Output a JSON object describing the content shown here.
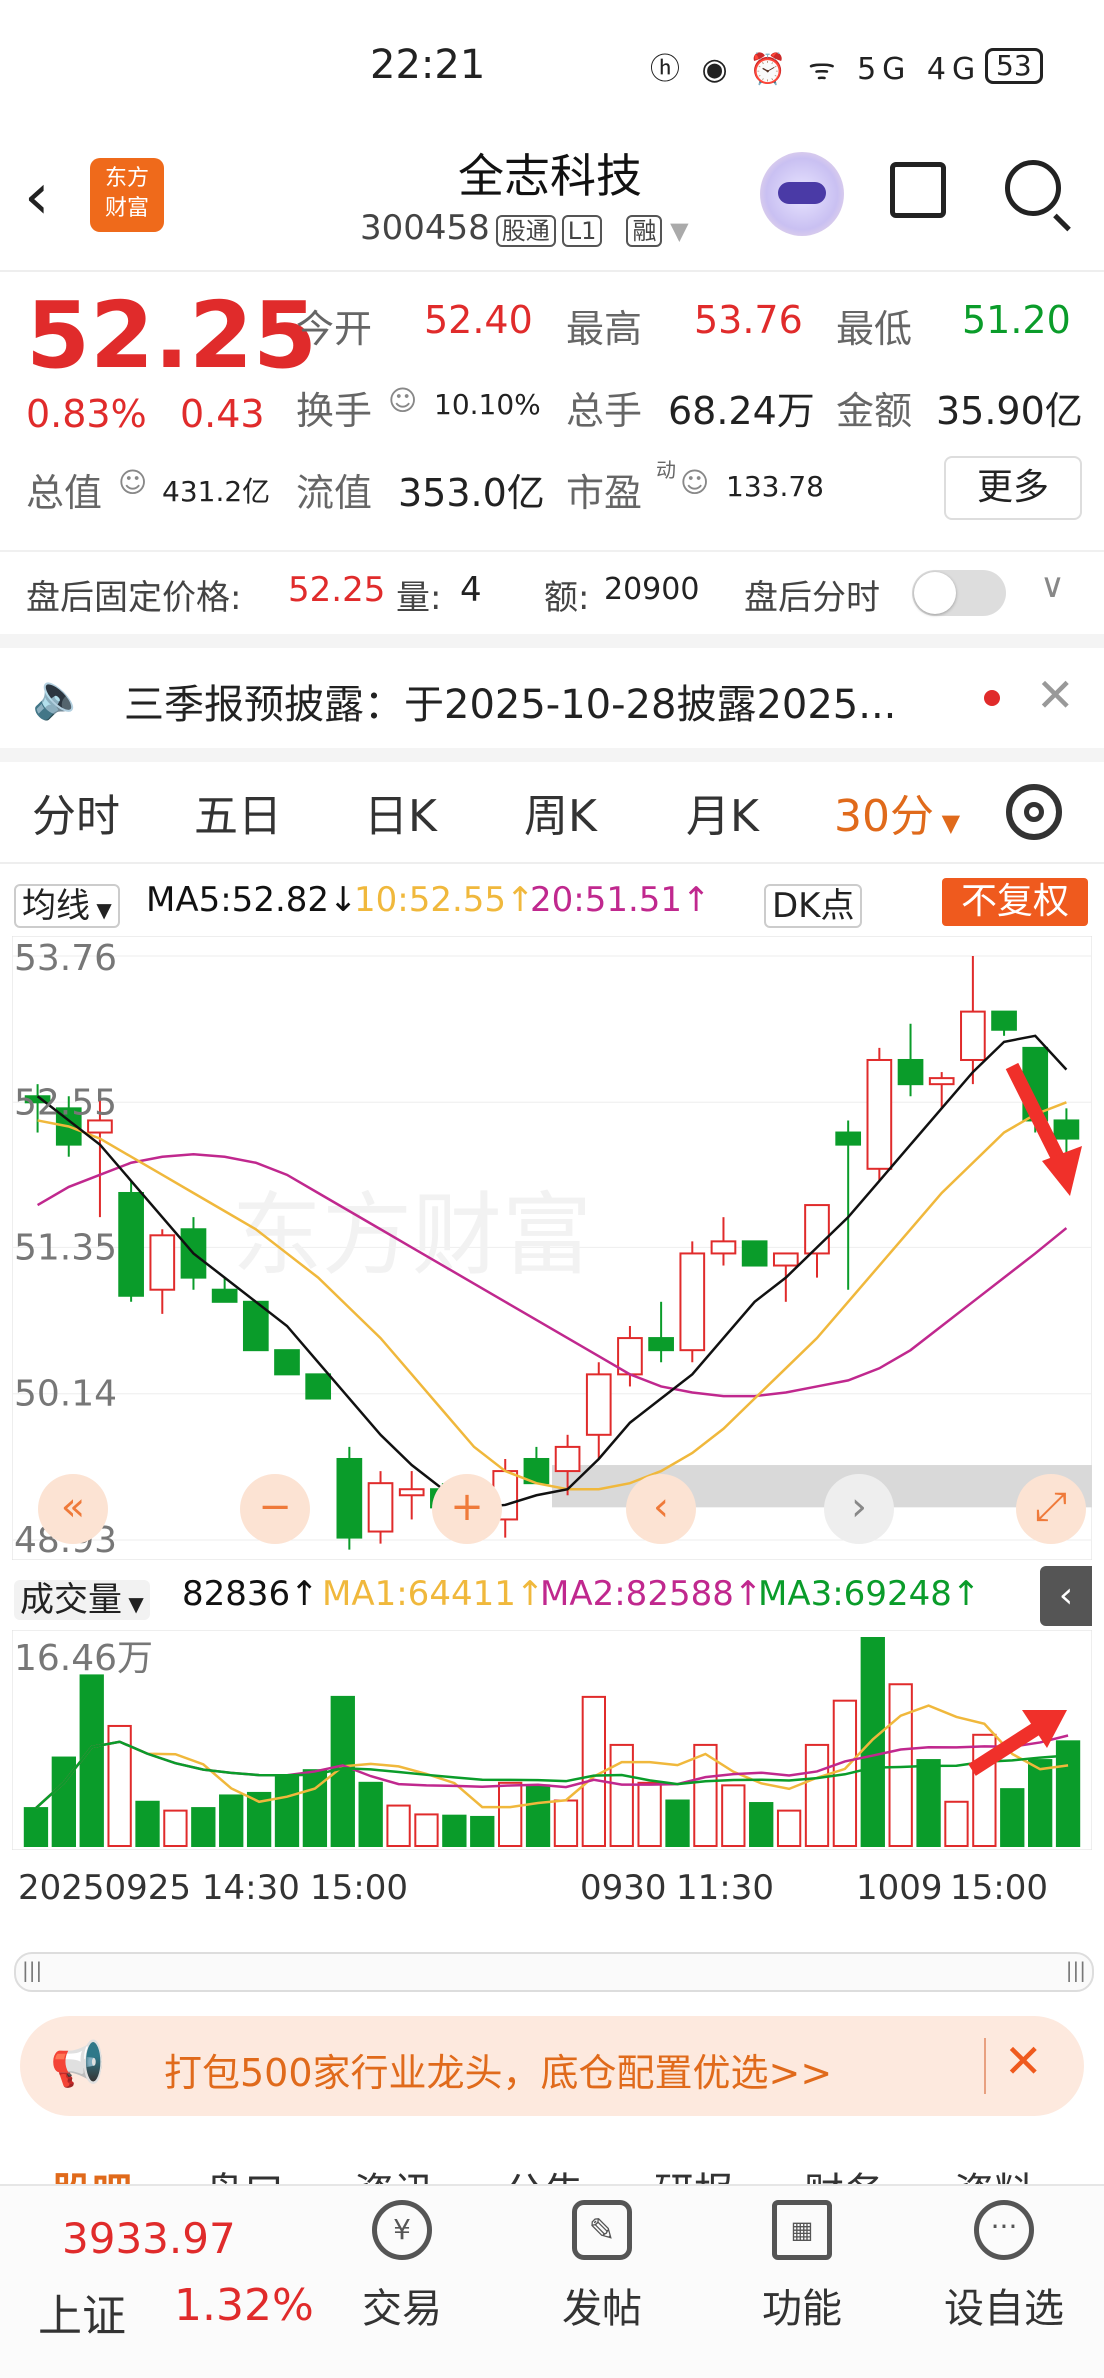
{
  "status_bar": {
    "time": "22:21",
    "icons": "ⓗ ◉ ⏰ ᯤ 5G 4G",
    "battery": "53"
  },
  "header": {
    "title": "全志科技",
    "code": "300458",
    "tags": [
      "股通",
      "L1",
      "融"
    ],
    "logo_line1": "东方",
    "logo_line2": "财富"
  },
  "quote": {
    "price": "52.25",
    "change_pct": "0.83%",
    "change": "0.43",
    "open_label": "今开",
    "open": "52.40",
    "high_label": "最高",
    "high": "53.76",
    "low_label": "最低",
    "low": "51.20",
    "turnover_label": "换手",
    "turnover": "10.10%",
    "volume_label": "总手",
    "volume": "68.24万",
    "amount_label": "金额",
    "amount": "35.90亿",
    "mktcap_label": "总值",
    "mktcap": "431.2亿",
    "float_label": "流值",
    "float": "353.0亿",
    "pe_label": "市盈",
    "pe_sup": "动",
    "pe": "133.78",
    "more": "更多"
  },
  "after_hours": {
    "label": "盘后固定价格:",
    "price": "52.25",
    "qty_label": "量:",
    "qty": "4",
    "amt_label": "额:",
    "amt": "20900",
    "tick_label": "盘后分时"
  },
  "notice": {
    "text": "三季报预披露：于2025-10-28披露2025..."
  },
  "tabs": [
    "分时",
    "五日",
    "日K",
    "周K",
    "月K",
    "30分"
  ],
  "ma_bar": {
    "selector": "均线",
    "ma5": "MA5:52.82↓",
    "ma10": "10:52.55↑",
    "ma20": "20:51.51↑",
    "dk": "DK点",
    "fq": "不复权"
  },
  "colors": {
    "up": "#e02b2b",
    "down": "#0a9c2a",
    "ma5": "#111111",
    "ma10": "#f0b83c",
    "ma20": "#c0288e",
    "accent": "#ef6a1b"
  },
  "watermark": "东方财富",
  "chart_data": {
    "type": "candlestick",
    "y_ticks": [
      "53.76",
      "52.55",
      "51.35",
      "50.14",
      "48.93"
    ],
    "ylim": [
      48.93,
      53.76
    ],
    "candles": [
      {
        "o": 52.6,
        "h": 52.7,
        "l": 52.3,
        "c": 52.55
      },
      {
        "o": 52.5,
        "h": 52.6,
        "l": 52.1,
        "c": 52.2
      },
      {
        "o": 52.3,
        "h": 52.6,
        "l": 51.6,
        "c": 52.4
      },
      {
        "o": 51.8,
        "h": 51.9,
        "l": 50.9,
        "c": 50.95
      },
      {
        "o": 51.0,
        "h": 51.5,
        "l": 50.8,
        "c": 51.45
      },
      {
        "o": 51.5,
        "h": 51.6,
        "l": 51.0,
        "c": 51.1
      },
      {
        "o": 51.0,
        "h": 51.1,
        "l": 50.9,
        "c": 50.9
      },
      {
        "o": 50.9,
        "h": 50.9,
        "l": 50.5,
        "c": 50.5
      },
      {
        "o": 50.5,
        "h": 50.5,
        "l": 50.3,
        "c": 50.3
      },
      {
        "o": 50.3,
        "h": 50.3,
        "l": 50.1,
        "c": 50.1
      },
      {
        "o": 49.6,
        "h": 49.7,
        "l": 48.85,
        "c": 48.95
      },
      {
        "o": 49.0,
        "h": 49.5,
        "l": 48.9,
        "c": 49.4
      },
      {
        "o": 49.3,
        "h": 49.5,
        "l": 49.1,
        "c": 49.35
      },
      {
        "o": 49.35,
        "h": 49.4,
        "l": 49.1,
        "c": 49.2
      },
      {
        "o": 49.2,
        "h": 49.3,
        "l": 49.0,
        "c": 49.05
      },
      {
        "o": 49.1,
        "h": 49.6,
        "l": 48.95,
        "c": 49.5
      },
      {
        "o": 49.6,
        "h": 49.7,
        "l": 49.4,
        "c": 49.4
      },
      {
        "o": 49.5,
        "h": 49.8,
        "l": 49.3,
        "c": 49.7
      },
      {
        "o": 49.8,
        "h": 50.4,
        "l": 49.6,
        "c": 50.3
      },
      {
        "o": 50.3,
        "h": 50.7,
        "l": 50.2,
        "c": 50.6
      },
      {
        "o": 50.6,
        "h": 50.9,
        "l": 50.4,
        "c": 50.5
      },
      {
        "o": 50.5,
        "h": 51.4,
        "l": 50.4,
        "c": 51.3
      },
      {
        "o": 51.3,
        "h": 51.6,
        "l": 51.2,
        "c": 51.4
      },
      {
        "o": 51.4,
        "h": 51.4,
        "l": 51.2,
        "c": 51.2
      },
      {
        "o": 51.2,
        "h": 51.3,
        "l": 50.9,
        "c": 51.3
      },
      {
        "o": 51.3,
        "h": 51.7,
        "l": 51.1,
        "c": 51.7
      },
      {
        "o": 52.3,
        "h": 52.4,
        "l": 51.0,
        "c": 52.2
      },
      {
        "o": 52.0,
        "h": 53.0,
        "l": 51.9,
        "c": 52.9
      },
      {
        "o": 52.9,
        "h": 53.2,
        "l": 52.6,
        "c": 52.7
      },
      {
        "o": 52.7,
        "h": 52.8,
        "l": 52.5,
        "c": 52.75
      },
      {
        "o": 52.9,
        "h": 53.76,
        "l": 52.7,
        "c": 53.3
      },
      {
        "o": 53.3,
        "h": 53.3,
        "l": 53.1,
        "c": 53.15
      },
      {
        "o": 53.0,
        "h": 53.0,
        "l": 52.3,
        "c": 52.4
      },
      {
        "o": 52.4,
        "h": 52.5,
        "l": 52.0,
        "c": 52.25
      }
    ],
    "ma5": [
      52.6,
      52.4,
      52.2,
      51.9,
      51.6,
      51.3,
      51.1,
      50.9,
      50.7,
      50.4,
      50.1,
      49.8,
      49.55,
      49.35,
      49.2,
      49.22,
      49.3,
      49.35,
      49.6,
      49.9,
      50.1,
      50.3,
      50.6,
      50.9,
      51.1,
      51.35,
      51.6,
      51.9,
      52.2,
      52.5,
      52.8,
      53.05,
      53.1,
      52.82
    ],
    "ma10": [
      52.4,
      52.35,
      52.25,
      52.1,
      51.95,
      51.8,
      51.65,
      51.5,
      51.3,
      51.1,
      50.85,
      50.6,
      50.3,
      50.0,
      49.7,
      49.5,
      49.4,
      49.35,
      49.35,
      49.4,
      49.5,
      49.65,
      49.85,
      50.1,
      50.35,
      50.6,
      50.9,
      51.2,
      51.5,
      51.8,
      52.05,
      52.3,
      52.45,
      52.55
    ],
    "ma20": [
      51.7,
      51.85,
      51.95,
      52.05,
      52.1,
      52.12,
      52.1,
      52.05,
      51.95,
      51.8,
      51.65,
      51.5,
      51.35,
      51.2,
      51.05,
      50.9,
      50.75,
      50.6,
      50.45,
      50.3,
      50.2,
      50.15,
      50.12,
      50.12,
      50.15,
      50.2,
      50.25,
      50.35,
      50.5,
      50.7,
      50.9,
      51.1,
      51.3,
      51.51
    ],
    "volume": {
      "label": "成交量",
      "current": "82836↑",
      "ma1": "MA1:64411↑",
      "ma2": "MA2:82588↑",
      "ma3": "MA3:69248↑",
      "max_label": "16.46万",
      "max": 164600,
      "values": [
        30000,
        70000,
        135000,
        95000,
        35000,
        28000,
        30000,
        40000,
        42000,
        55000,
        60000,
        118000,
        50000,
        32000,
        25000,
        24000,
        23000,
        50000,
        48000,
        36000,
        118000,
        80000,
        50000,
        36000,
        80000,
        48000,
        34000,
        28000,
        80000,
        115000,
        164600,
        128000,
        68000,
        35000,
        88000,
        45000,
        68000,
        82836
      ]
    },
    "x_ticks": [
      "20250925 14:30",
      "15:00",
      "0930",
      "11:30",
      "1009",
      "15:00"
    ]
  },
  "ad": {
    "text": "打包500家行业龙头，底仓配置优选>>"
  },
  "subtabs": [
    "股吧",
    "盘口",
    "资讯",
    "公告",
    "研报",
    "财务",
    "资料"
  ],
  "bottom": {
    "index_value": "3933.97",
    "index_name": "上证",
    "index_pct": "1.32%",
    "items": [
      "交易",
      "发帖",
      "功能",
      "设自选"
    ]
  }
}
